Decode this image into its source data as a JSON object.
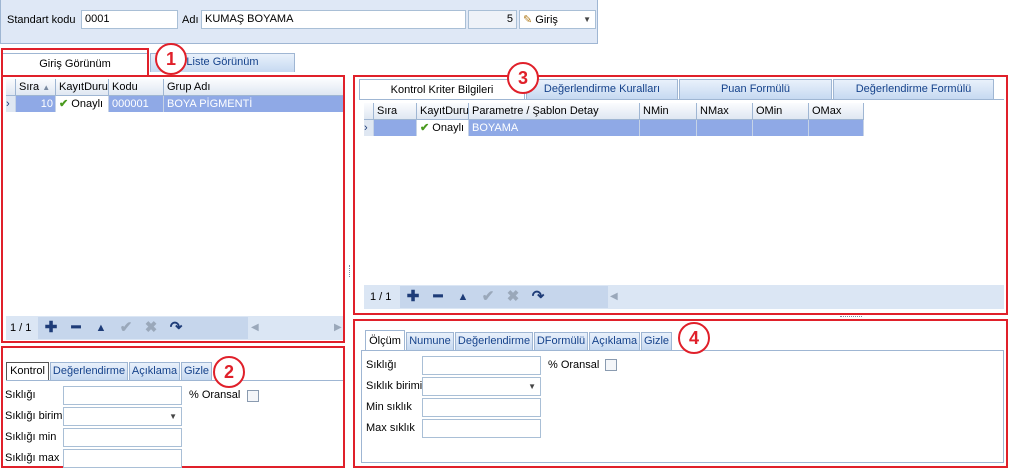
{
  "header": {
    "standart_kodu_label": "Standart kodu",
    "standart_kodu_value": "0001",
    "adi_label": "Adı",
    "adi_value": "KUMAŞ BOYAMA",
    "count_value": "5",
    "giris_label": "Giriş"
  },
  "main_tabs": [
    {
      "label": "Giriş Görünüm"
    },
    {
      "label": "Liste Görünüm"
    }
  ],
  "badges": [
    "1",
    "2",
    "3",
    "4"
  ],
  "left_grid": {
    "columns": [
      "Sıra",
      "KayıtDurum",
      "Kodu",
      "Grup Adı"
    ],
    "rows": [
      {
        "sira": "10",
        "durum": "Onaylı",
        "kodu": "000001",
        "grup": "BOYA PİGMENTİ"
      }
    ],
    "pager": "1 / 1"
  },
  "left_detail_tabs": [
    "Kontrol",
    "Değerlendirme",
    "Açıklama",
    "Gizle"
  ],
  "left_detail_fields": {
    "sikligi": "Sıklığı",
    "oransal": "% Oransal",
    "sikligi_birimi": "Sıklığı birimi",
    "sikligi_min": "Sıklığı min",
    "sikligi_max": "Sıklığı max"
  },
  "right_tabs": [
    "Kontrol Kriter Bilgileri",
    "Değerlendirme Kuralları",
    "Puan Formülü",
    "Değerlendirme Formülü"
  ],
  "right_grid": {
    "columns": [
      "Sıra",
      "KayıtDurum",
      "Parametre / Şablon Detay",
      "NMin",
      "NMax",
      "OMin",
      "OMax"
    ],
    "rows": [
      {
        "sira": "",
        "durum": "Onaylı",
        "param": "BOYAMA",
        "nmin": "",
        "nmax": "",
        "omin": "",
        "omax": ""
      }
    ],
    "pager": "1 / 1"
  },
  "right_detail_tabs": [
    "Ölçüm",
    "Numune",
    "Değerlendirme",
    "DFormülü",
    "Açıklama",
    "Gizle"
  ],
  "right_detail_fields": {
    "sikligi": "Sıklığı",
    "oransal": "% Oransal",
    "siklik_birimi": "Sıklık birimi",
    "min_siklik": "Min sıklık",
    "max_siklik": "Max sıklık"
  }
}
